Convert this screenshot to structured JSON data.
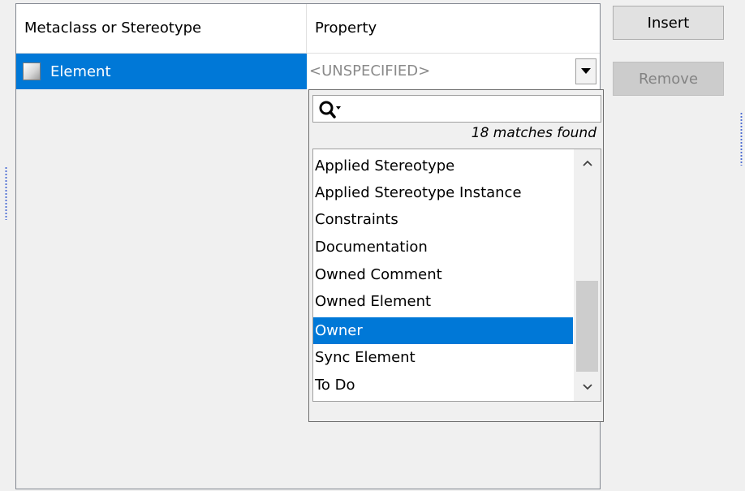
{
  "table": {
    "headers": [
      "Metaclass or Stereotype",
      "Property"
    ],
    "rows": [
      {
        "metaclass": "Element",
        "icon": "element-metaclass-icon",
        "property": "<UNSPECIFIED>"
      }
    ]
  },
  "dropdown": {
    "search_value": "",
    "matches_text": "18 matches found",
    "items": [
      "Applied Stereotype",
      "Applied Stereotype Instance",
      "Constraints",
      "Documentation",
      "Owned Comment",
      "Owned Element",
      "Owner",
      "Sync Element",
      "To Do"
    ],
    "selected_item": "Owner",
    "scroll_thumb_position": 0.55
  },
  "buttons": {
    "insert_label": "Insert",
    "remove_label": "Remove"
  },
  "colors": {
    "selection": "#0078d7",
    "panel_background": "#f0f0f0",
    "splitter_dots": "#4a6bd3"
  }
}
